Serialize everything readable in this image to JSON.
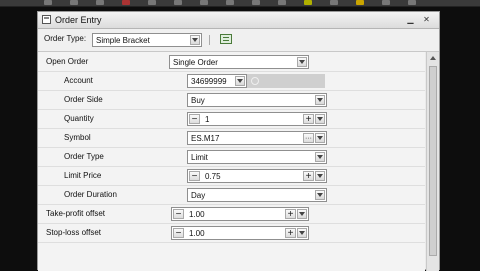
{
  "window": {
    "title": "Order Entry"
  },
  "toolbar": {
    "order_type_label": "Order Type:",
    "order_type_value": "Simple Bracket"
  },
  "fields": {
    "open_order": {
      "label": "Open Order",
      "value": "Single Order"
    },
    "account": {
      "label": "Account",
      "value": "34699999"
    },
    "order_side": {
      "label": "Order Side",
      "value": "Buy"
    },
    "quantity": {
      "label": "Quantity",
      "value": "1",
      "minus": "−",
      "plus": "+"
    },
    "symbol": {
      "label": "Symbol",
      "value": "ES.M17",
      "more": "···"
    },
    "order_type": {
      "label": "Order Type",
      "value": "Limit"
    },
    "limit_price": {
      "label": "Limit Price",
      "value": "0.75",
      "minus": "−",
      "plus": "+"
    },
    "order_duration": {
      "label": "Order Duration",
      "value": "Day"
    },
    "take_profit": {
      "label": "Take-profit offset",
      "value": "1.00",
      "minus": "−",
      "plus": "+"
    },
    "stop_loss": {
      "label": "Stop-loss offset",
      "value": "1.00",
      "minus": "−",
      "plus": "+"
    }
  }
}
